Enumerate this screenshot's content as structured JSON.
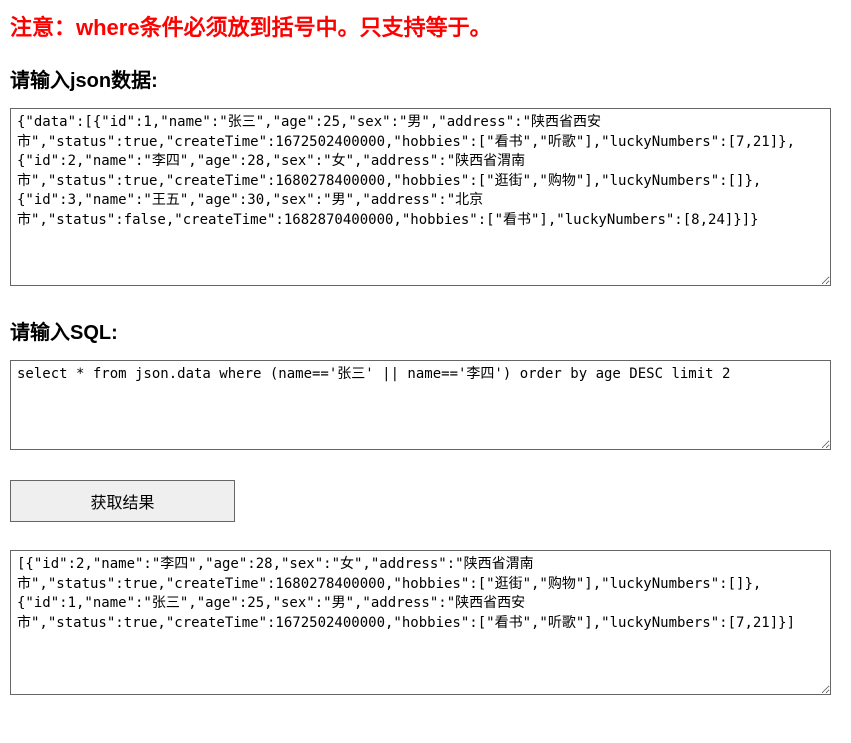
{
  "warning_text": "注意：where条件必须放到括号中。只支持等于。",
  "json_input": {
    "label": "请输入json数据:",
    "value": "{\"data\":[{\"id\":1,\"name\":\"张三\",\"age\":25,\"sex\":\"男\",\"address\":\"陕西省西安市\",\"status\":true,\"createTime\":1672502400000,\"hobbies\":[\"看书\",\"听歌\"],\"luckyNumbers\":[7,21]},{\"id\":2,\"name\":\"李四\",\"age\":28,\"sex\":\"女\",\"address\":\"陕西省渭南市\",\"status\":true,\"createTime\":1680278400000,\"hobbies\":[\"逛街\",\"购物\"],\"luckyNumbers\":[]},{\"id\":3,\"name\":\"王五\",\"age\":30,\"sex\":\"男\",\"address\":\"北京市\",\"status\":false,\"createTime\":1682870400000,\"hobbies\":[\"看书\"],\"luckyNumbers\":[8,24]}]}"
  },
  "sql_input": {
    "label": "请输入SQL:",
    "value": "select * from json.data where (name=='张三' || name=='李四') order by age DESC limit 2"
  },
  "button": {
    "label": "获取结果"
  },
  "result": {
    "value": "[{\"id\":2,\"name\":\"李四\",\"age\":28,\"sex\":\"女\",\"address\":\"陕西省渭南市\",\"status\":true,\"createTime\":1680278400000,\"hobbies\":[\"逛街\",\"购物\"],\"luckyNumbers\":[]},{\"id\":1,\"name\":\"张三\",\"age\":25,\"sex\":\"男\",\"address\":\"陕西省西安市\",\"status\":true,\"createTime\":1672502400000,\"hobbies\":[\"看书\",\"听歌\"],\"luckyNumbers\":[7,21]}]"
  }
}
